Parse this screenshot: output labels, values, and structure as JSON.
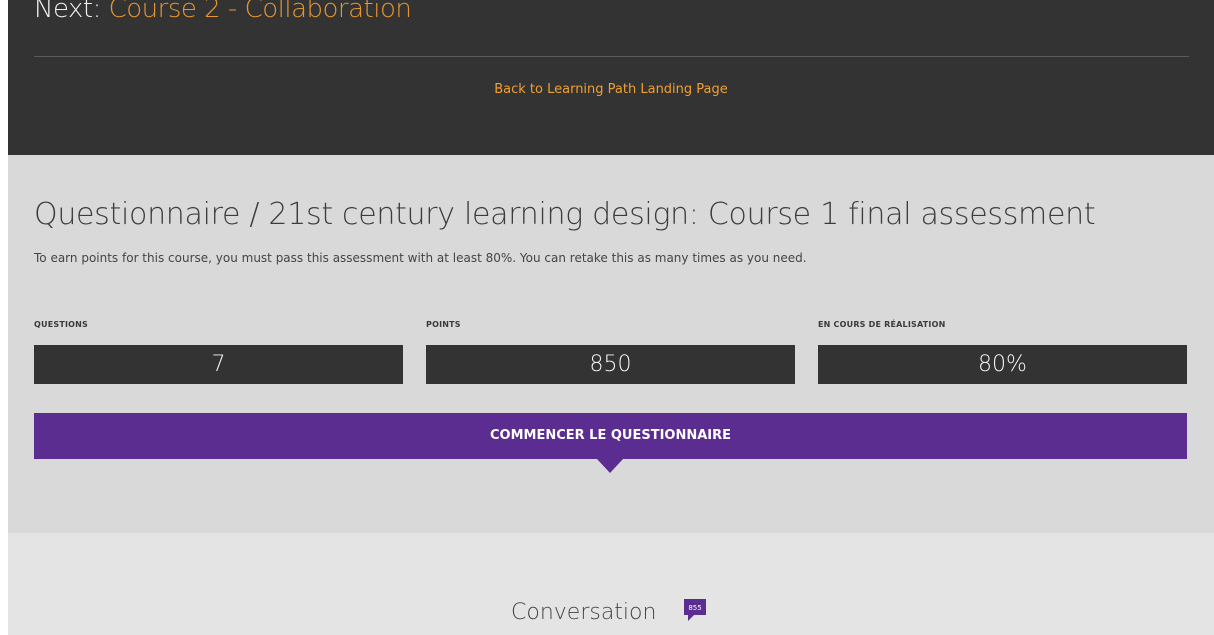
{
  "header": {
    "next_prefix": "Next: ",
    "next_course": "Course 2 - Collaboration",
    "back_link": "Back to Learning Path Landing Page"
  },
  "assessment": {
    "title": "Questionnaire / 21st century learning design: Course 1 final assessment",
    "description": "To earn points for this course, you must pass this assessment with at least 80%. You can retake this as many times as you need.",
    "stats": [
      {
        "label": "QUESTIONS",
        "value": "7"
      },
      {
        "label": "POINTS",
        "value": "850"
      },
      {
        "label": "EN COURS DE RÉALISATION",
        "value": "80%"
      }
    ],
    "start_button": "COMMENCER LE QUESTIONNAIRE"
  },
  "conversation": {
    "title": "Conversation",
    "count": "855"
  },
  "colors": {
    "header_bg": "#333333",
    "accent_orange": "#e8962f",
    "panel_bg": "#d9d9d9",
    "button_purple": "#5c2d91",
    "conversation_bg": "#e4e4e4"
  }
}
